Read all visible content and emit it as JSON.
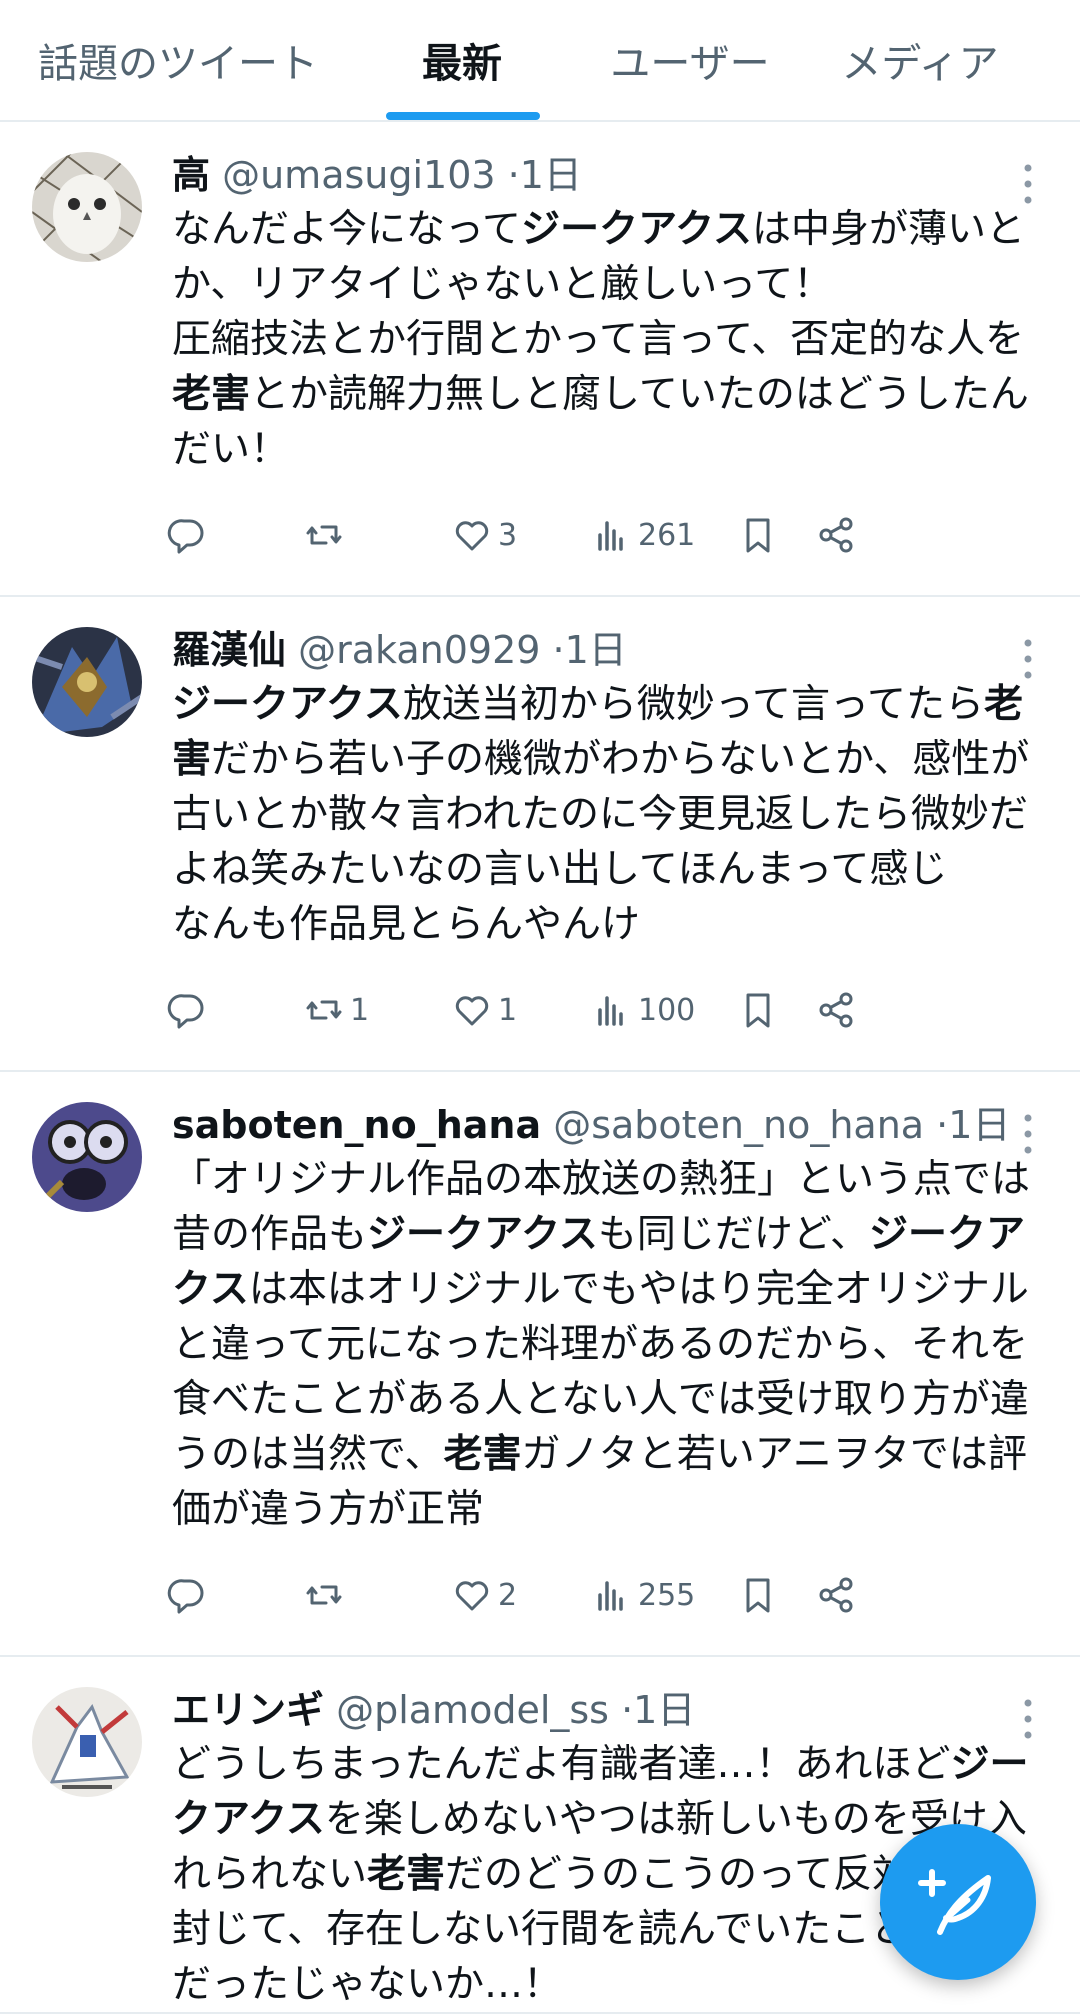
{
  "tabs": [
    {
      "label": "話題のツイート",
      "active": false
    },
    {
      "label": "最新",
      "active": true
    },
    {
      "label": "ユーザー",
      "active": false
    },
    {
      "label": "メディア",
      "active": false
    }
  ],
  "accent": "#1d9bf0",
  "tweets": [
    {
      "name": "高",
      "handle": "@umasugi103",
      "dot": "·",
      "time": "1日",
      "avatar_icon": "owl-avatar",
      "body": [
        {
          "t": "なんだよ今になって"
        },
        {
          "t": "ジークアクス",
          "b": true
        },
        {
          "t": "は中身が薄いとか、リアタイじゃないと厳しいって！\n圧縮技法とか行間とかって言って、否定的な人を"
        },
        {
          "t": "老害",
          "b": true
        },
        {
          "t": "とか読解力無しと腐していたのはどうしたんだい！"
        }
      ],
      "retweets": "",
      "likes": "3",
      "views": "261"
    },
    {
      "name": "羅漢仙",
      "handle": "@rakan0929",
      "dot": "·",
      "time": "1日",
      "avatar_icon": "robot-figure-avatar",
      "body": [
        {
          "t": "ジークアクス",
          "b": true
        },
        {
          "t": "放送当初から微妙って言ってたら"
        },
        {
          "t": "老害",
          "b": true
        },
        {
          "t": "だから若い子の機微がわからないとか、感性が古いとか散々言われたのに今更見返したら微妙だよね笑みたいなの言い出してほんまって感じ\nなんも作品見とらんやんけ"
        }
      ],
      "retweets": "1",
      "likes": "1",
      "views": "100"
    },
    {
      "name": "saboten_no_hana",
      "handle": "@saboten_no_hana",
      "dot": "·",
      "time": "1日",
      "avatar_icon": "screaming-face-avatar",
      "body": [
        {
          "t": "「オリジナル作品の本放送の熱狂」という点では昔の作品も"
        },
        {
          "t": "ジークアクス",
          "b": true
        },
        {
          "t": "も同じだけど、"
        },
        {
          "t": "ジークアクス",
          "b": true
        },
        {
          "t": "は本はオリジナルでもやはり完全オリジナルと違って元になった料理があるのだから、それを食べたことがある人とない人では受け取り方が違うのは当然で、"
        },
        {
          "t": "老害",
          "b": true
        },
        {
          "t": "ガノタと若いアニヲタでは評価が違う方が正常"
        }
      ],
      "retweets": "",
      "likes": "2",
      "views": "255"
    },
    {
      "name": "エリンギ",
      "handle": "@plamodel_ss",
      "dot": "·",
      "time": "1日",
      "avatar_icon": "plamodel-avatar",
      "body": [
        {
          "t": "どうしちまったんだよ有識者達…！あれほど"
        },
        {
          "t": "ジークアクス",
          "b": true
        },
        {
          "t": "を楽しめないやつは新しいものを受け入れられない"
        },
        {
          "t": "老害",
          "b": true
        },
        {
          "t": "だのどうのこうのって反対意見を封じて、存在しない行間を読んでいたことに必死だったじゃないか…！"
        }
      ],
      "retweets": "",
      "likes": "",
      "views": ""
    }
  ],
  "fab": {
    "icon": "compose-feather-plus-icon"
  }
}
